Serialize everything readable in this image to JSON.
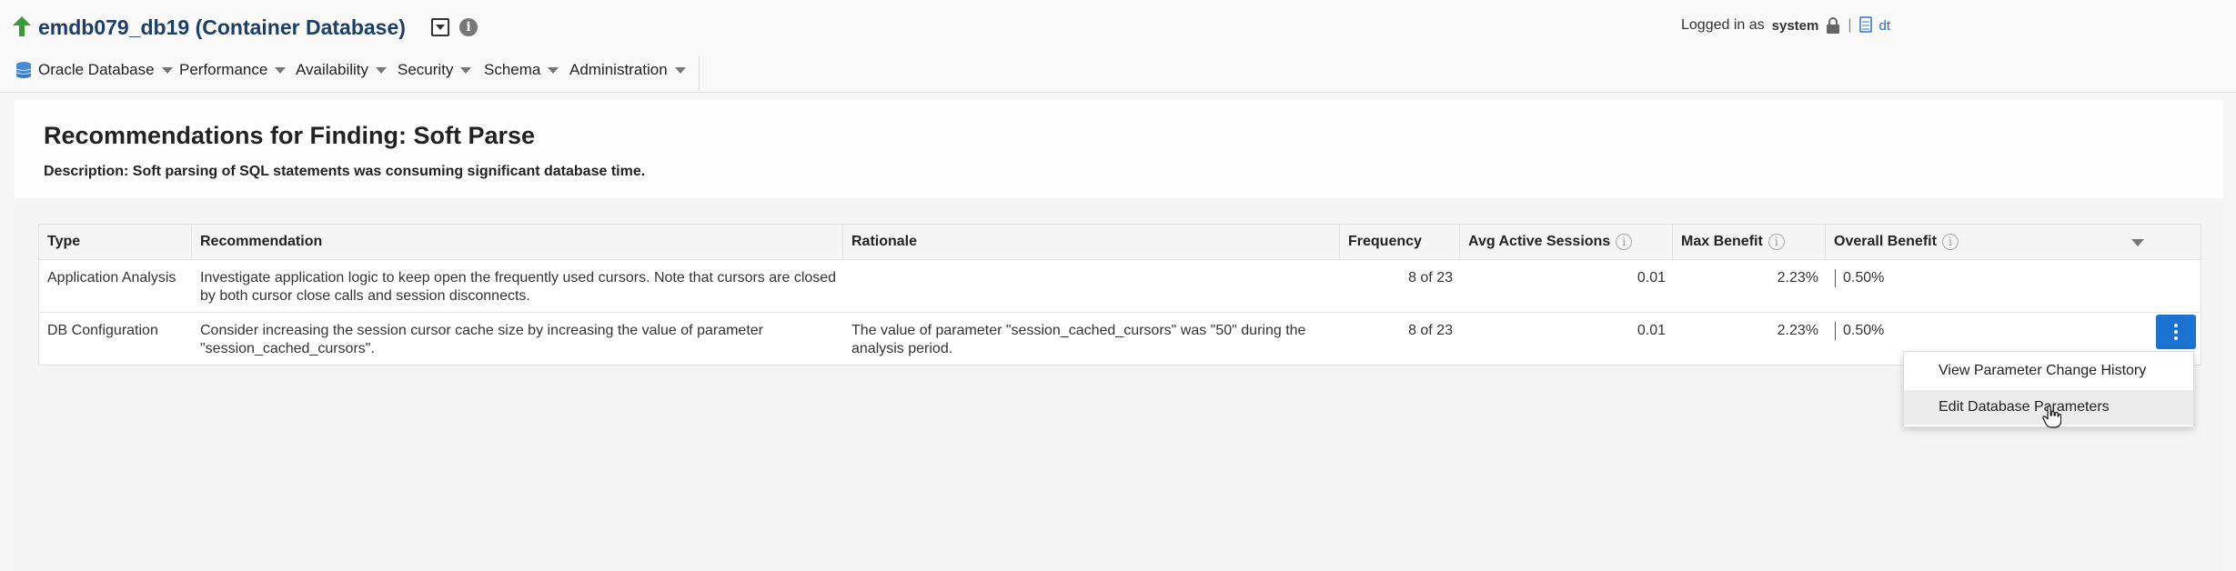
{
  "header": {
    "title": "emdb079_db19 (Container Database)",
    "logged_in_label": "Logged in as",
    "user": "system",
    "host": "dt"
  },
  "menu": {
    "items": [
      {
        "label": "Oracle Database"
      },
      {
        "label": "Performance"
      },
      {
        "label": "Availability"
      },
      {
        "label": "Security"
      },
      {
        "label": "Schema"
      },
      {
        "label": "Administration"
      }
    ]
  },
  "page": {
    "title": "Recommendations for Finding: Soft Parse",
    "description": "Description: Soft parsing of SQL statements was consuming significant database time."
  },
  "table": {
    "columns": [
      "Type",
      "Recommendation",
      "Rationale",
      "Frequency",
      "Avg Active Sessions",
      "Max Benefit",
      "Overall Benefit"
    ],
    "rows": [
      {
        "type": "Application Analysis",
        "recommendation": "Investigate application logic to keep open the frequently used cursors. Note that cursors are closed by both cursor close calls and session disconnects.",
        "rationale": "",
        "frequency": "8 of 23",
        "avg_active_sessions": "0.01",
        "max_benefit": "2.23%",
        "overall_benefit": "0.50%"
      },
      {
        "type": "DB Configuration",
        "recommendation": "Consider increasing the session cursor cache size by increasing the value of parameter \"session_cached_cursors\".",
        "rationale": "The value of parameter \"session_cached_cursors\" was \"50\" during the analysis period.",
        "frequency": "8 of 23",
        "avg_active_sessions": "0.01",
        "max_benefit": "2.23%",
        "overall_benefit": "0.50%"
      }
    ]
  },
  "popup_menu": {
    "items": [
      "View Parameter Change History",
      "Edit Database Parameters"
    ]
  },
  "colors": {
    "title_blue": "#1b3f66",
    "accent_blue": "#1a73d0",
    "up_arrow_green": "#3a9a3a"
  }
}
